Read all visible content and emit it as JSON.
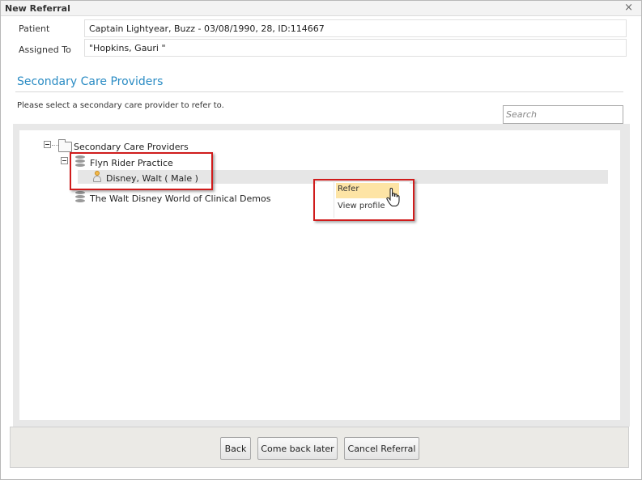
{
  "dialog": {
    "title": "New Referral",
    "close_glyph": "×"
  },
  "patient": {
    "label": "Patient",
    "value": "Captain Lightyear, Buzz - 03/08/1990, 28, ID:114667"
  },
  "assigned": {
    "label": "Assigned To",
    "value": "\"Hopkins, Gauri \""
  },
  "section": {
    "title": "Secondary Care Providers",
    "instruction": "Please select a secondary care provider to refer to."
  },
  "search": {
    "placeholder": "Search",
    "value": ""
  },
  "tree": {
    "root": "Secondary Care Providers",
    "practice1": "Flyn Rider Practice",
    "practice1_child": "Disney, Walt ( Male )",
    "practice2": "The Walt Disney World of Clinical Demos"
  },
  "context_menu": {
    "items": [
      "Refer",
      "View profile"
    ],
    "active": "Refer"
  },
  "buttons": {
    "back": "Back",
    "come_back_later": "Come back later",
    "cancel": "Cancel Referral"
  },
  "colors": {
    "accent": "#2b8cc4",
    "highlight_box": "#d01c1c",
    "menu_active": "#fde4a5"
  }
}
